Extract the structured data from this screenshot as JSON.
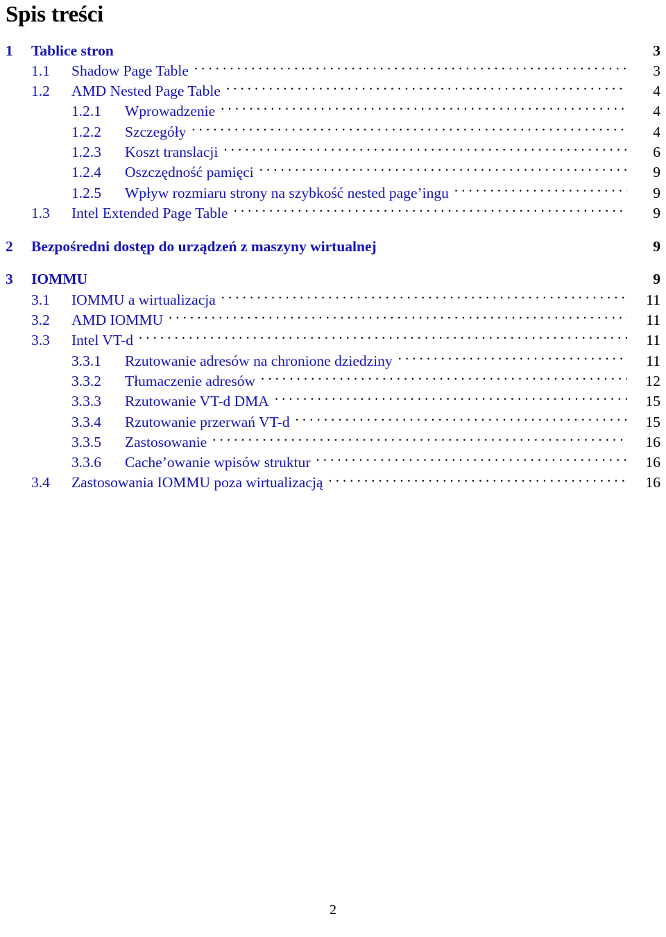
{
  "document": {
    "title": "Spis treści",
    "footer_page_number": "2",
    "colors": {
      "entry_text": "#1414b8",
      "page_number": "#000000",
      "leader_dots": "#000000",
      "title": "#000000"
    }
  },
  "toc": {
    "entries": [
      {
        "level": 1,
        "number": "1",
        "label": "Tablice stron",
        "page": "3",
        "leader": false,
        "gap_before": false
      },
      {
        "level": 2,
        "number": "1.1",
        "label": "Shadow Page Table",
        "page": "3",
        "leader": true,
        "gap_before": false
      },
      {
        "level": 2,
        "number": "1.2",
        "label": "AMD Nested Page Table",
        "page": "4",
        "leader": true,
        "gap_before": false
      },
      {
        "level": 3,
        "number": "1.2.1",
        "label": "Wprowadzenie",
        "page": "4",
        "leader": true,
        "gap_before": false
      },
      {
        "level": 3,
        "number": "1.2.2",
        "label": "Szczegóły",
        "page": "4",
        "leader": true,
        "gap_before": false
      },
      {
        "level": 3,
        "number": "1.2.3",
        "label": "Koszt translacji",
        "page": "6",
        "leader": true,
        "gap_before": false
      },
      {
        "level": 3,
        "number": "1.2.4",
        "label": "Oszczędność pamięci",
        "page": "9",
        "leader": true,
        "gap_before": false
      },
      {
        "level": 3,
        "number": "1.2.5",
        "label": "Wpływ rozmiaru strony na szybkość nested page’ingu",
        "page": "9",
        "leader": true,
        "gap_before": false
      },
      {
        "level": 2,
        "number": "1.3",
        "label": "Intel Extended Page Table",
        "page": "9",
        "leader": true,
        "gap_before": false
      },
      {
        "level": 1,
        "number": "2",
        "label": "Bezpośredni dostęp do urządzeń z maszyny wirtualnej",
        "page": "9",
        "leader": false,
        "gap_before": true
      },
      {
        "level": 1,
        "number": "3",
        "label": "IOMMU",
        "page": "9",
        "leader": false,
        "gap_before": true
      },
      {
        "level": 2,
        "number": "3.1",
        "label": "IOMMU a wirtualizacja",
        "page": "11",
        "leader": true,
        "gap_before": false
      },
      {
        "level": 2,
        "number": "3.2",
        "label": "AMD IOMMU",
        "page": "11",
        "leader": true,
        "gap_before": false
      },
      {
        "level": 2,
        "number": "3.3",
        "label": "Intel VT-d",
        "page": "11",
        "leader": true,
        "gap_before": false
      },
      {
        "level": 3,
        "number": "3.3.1",
        "label": "Rzutowanie adresów na chronione dziedziny",
        "page": "11",
        "leader": true,
        "gap_before": false
      },
      {
        "level": 3,
        "number": "3.3.2",
        "label": "Tłumaczenie adresów",
        "page": "12",
        "leader": true,
        "gap_before": false
      },
      {
        "level": 3,
        "number": "3.3.3",
        "label": "Rzutowanie VT-d DMA",
        "page": "15",
        "leader": true,
        "gap_before": false
      },
      {
        "level": 3,
        "number": "3.3.4",
        "label": "Rzutowanie przerwań VT-d",
        "page": "15",
        "leader": true,
        "gap_before": false
      },
      {
        "level": 3,
        "number": "3.3.5",
        "label": "Zastosowanie",
        "page": "16",
        "leader": true,
        "gap_before": false
      },
      {
        "level": 3,
        "number": "3.3.6",
        "label": "Cache’owanie wpisów struktur",
        "page": "16",
        "leader": true,
        "gap_before": false
      },
      {
        "level": 2,
        "number": "3.4",
        "label": "Zastosowania IOMMU poza wirtualizacją",
        "page": "16",
        "leader": true,
        "gap_before": false
      }
    ]
  }
}
